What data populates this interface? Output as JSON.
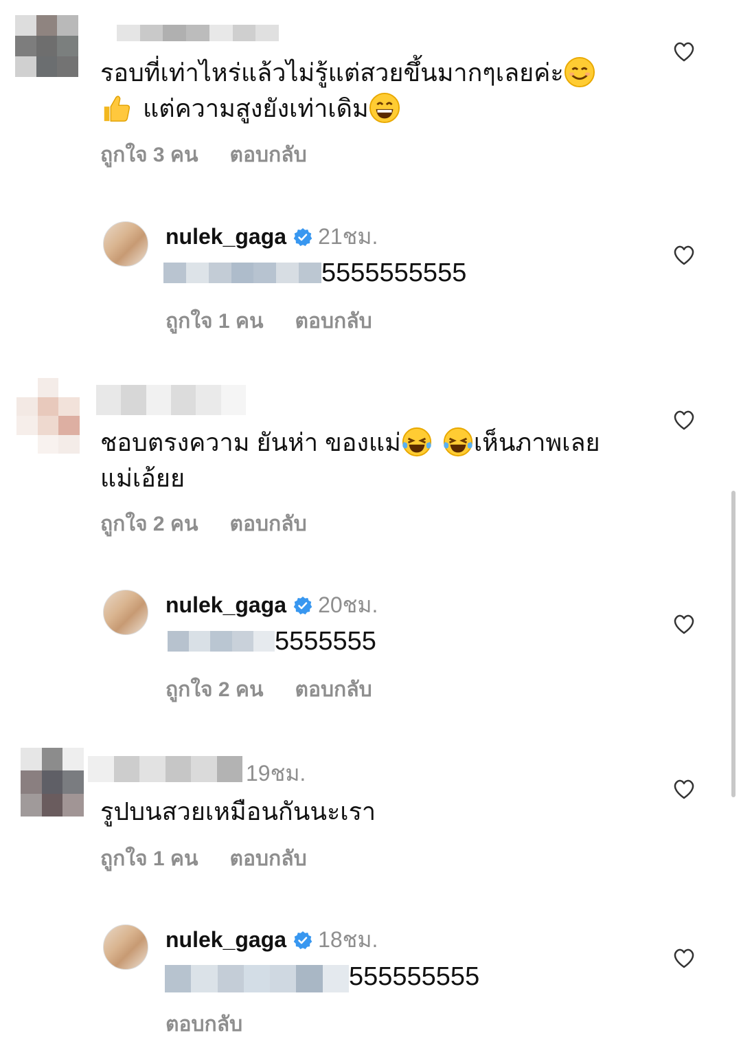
{
  "comments": [
    {
      "text_line1": "รอบที่เท่าไหร่แล้วไม่รู้แต่สวยขึ้นมากๆเลยค่ะ",
      "text_line2": "แต่ความสูงยังเท่าเดิม",
      "likes": "ถูกใจ 3 คน",
      "reply_label": "ตอบกลับ",
      "emojis": [
        "smiling-face-icon",
        "thumbs-up-icon",
        "grinning-face-icon"
      ]
    },
    {
      "text_line1": "ชอบตรงความ ยันห่า ของแม่",
      "text_line1_after": "เห็นภาพเลย",
      "text_line2": "แม่เอ้ยย",
      "likes": "ถูกใจ 2 คน",
      "reply_label": "ตอบกลับ",
      "emojis": [
        "tears-of-joy-icon",
        "tears-of-joy-icon"
      ]
    },
    {
      "time": "19ชม.",
      "text_line1": "รูปบนสวยเหมือนกันนะเรา",
      "likes": "ถูกใจ 1 คน",
      "reply_label": "ตอบกลับ"
    }
  ],
  "replies": [
    {
      "username": "nulek_gaga",
      "time": "21ชม.",
      "text": "5555555555",
      "likes": "ถูกใจ 1 คน",
      "reply_label": "ตอบกลับ"
    },
    {
      "username": "nulek_gaga",
      "time": "20ชม.",
      "text": "5555555",
      "likes": "ถูกใจ 2 คน",
      "reply_label": "ตอบกลับ"
    },
    {
      "username": "nulek_gaga",
      "time": "18ชม.",
      "text": "555555555",
      "reply_label": "ตอบกลับ"
    }
  ],
  "colors": {
    "meta": "#8e8e8e",
    "verified": "#3897f0",
    "text": "#111111"
  }
}
